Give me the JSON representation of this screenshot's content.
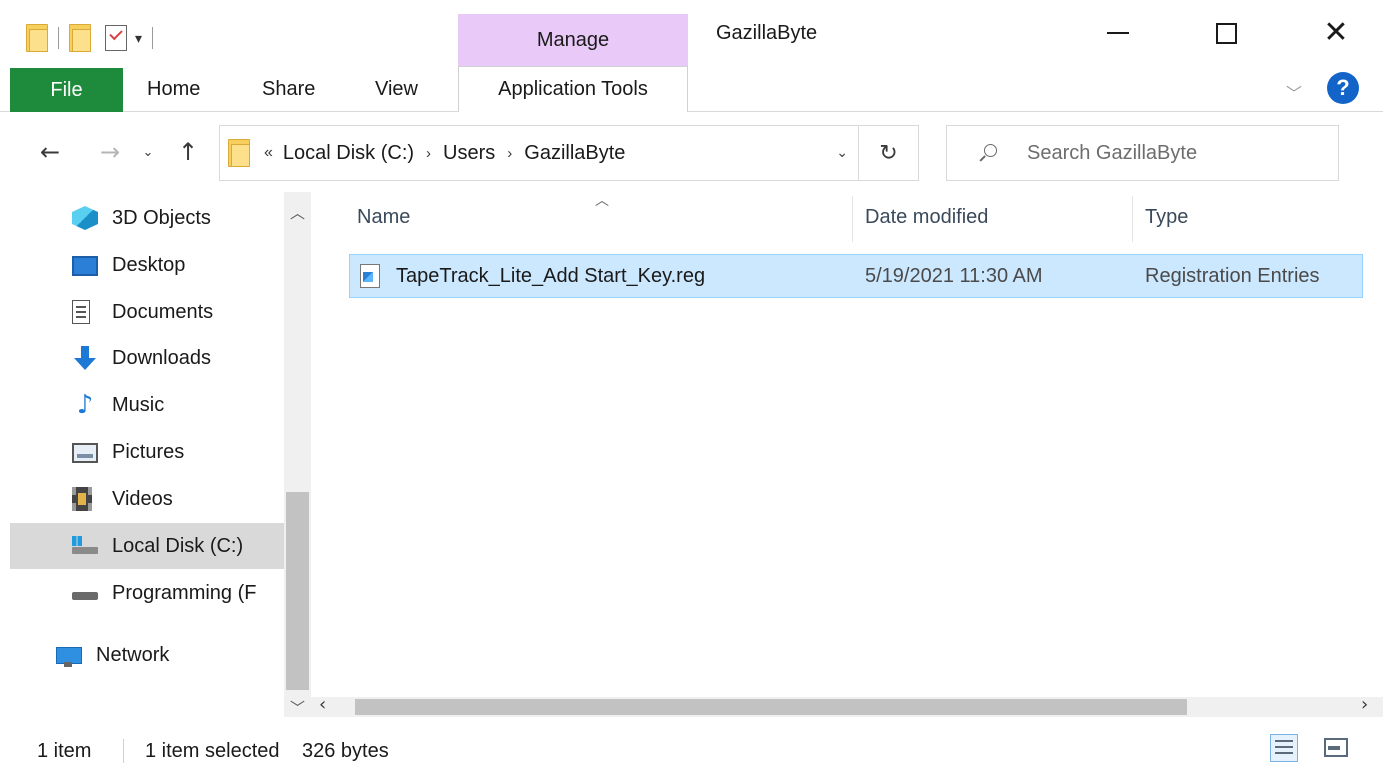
{
  "window": {
    "title": "GazillaByte",
    "context_tab_label": "Manage",
    "accent_color": "#1e8a3c",
    "context_color": "#e8c9f7"
  },
  "ribbon": {
    "tabs": [
      {
        "label": "File"
      },
      {
        "label": "Home"
      },
      {
        "label": "Share"
      },
      {
        "label": "View"
      },
      {
        "label": "Application Tools"
      }
    ],
    "help_label": "?"
  },
  "address": {
    "overflow": "«",
    "crumbs": [
      "Local Disk (C:)",
      "Users",
      "GazillaByte"
    ],
    "separator": "›"
  },
  "search": {
    "placeholder": "Search GazillaByte"
  },
  "nav_pane": {
    "items": [
      {
        "label": "3D Objects",
        "icon": "3d-objects-icon"
      },
      {
        "label": "Desktop",
        "icon": "desktop-icon"
      },
      {
        "label": "Documents",
        "icon": "documents-icon"
      },
      {
        "label": "Downloads",
        "icon": "downloads-icon"
      },
      {
        "label": "Music",
        "icon": "music-icon"
      },
      {
        "label": "Pictures",
        "icon": "pictures-icon"
      },
      {
        "label": "Videos",
        "icon": "videos-icon"
      },
      {
        "label": "Local Disk (C:)",
        "icon": "local-disk-icon",
        "selected": true
      },
      {
        "label": "Programming (F",
        "icon": "drive-icon"
      },
      {
        "label": "Network",
        "icon": "network-icon"
      }
    ]
  },
  "file_list": {
    "columns": [
      "Name",
      "Date modified",
      "Type"
    ],
    "rows": [
      {
        "name": "TapeTrack_Lite_Add Start_Key.reg",
        "date_modified": "5/19/2021 11:30 AM",
        "type": "Registration Entries",
        "selected": true
      }
    ]
  },
  "status": {
    "item_count": "1 item",
    "selected": "1 item selected",
    "size": "326 bytes"
  }
}
